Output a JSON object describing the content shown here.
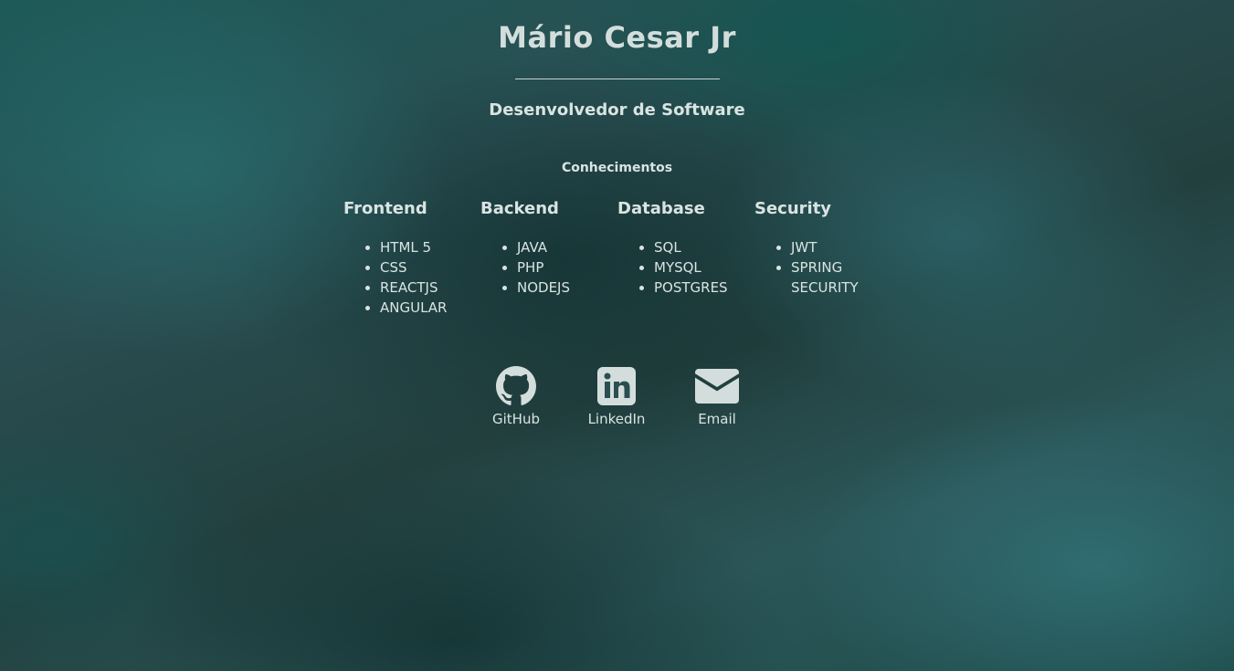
{
  "header": {
    "name": "Mário Cesar Jr",
    "role": "Desenvolvedor de Software"
  },
  "skills": {
    "title": "Conhecimentos",
    "columns": [
      {
        "title": "Frontend",
        "items": [
          "HTML 5",
          "CSS",
          "REACTJS",
          "ANGULAR"
        ]
      },
      {
        "title": "Backend",
        "items": [
          "JAVA",
          "PHP",
          "NODEJS"
        ]
      },
      {
        "title": "Database",
        "items": [
          "SQL",
          "MYSQL",
          "POSTGRES"
        ]
      },
      {
        "title": "Security",
        "items": [
          "JWT",
          "SPRING SECURITY"
        ]
      }
    ]
  },
  "links": [
    {
      "label": "GitHub",
      "icon": "github-icon"
    },
    {
      "label": "LinkedIn",
      "icon": "linkedin-icon"
    },
    {
      "label": "Email",
      "icon": "email-icon"
    }
  ],
  "colors": {
    "text": "#d9e4e2",
    "background": "#2a4e52"
  }
}
